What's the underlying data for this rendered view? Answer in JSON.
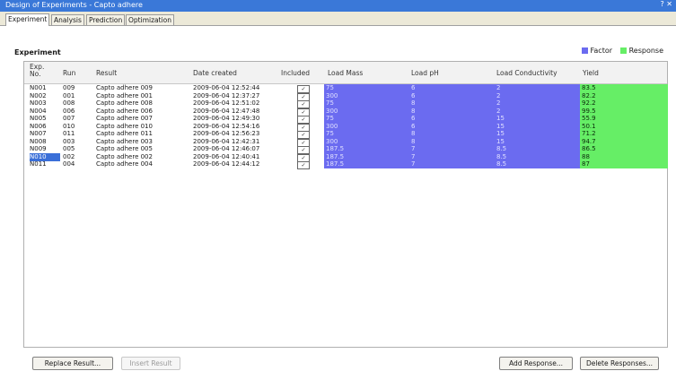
{
  "window": {
    "title": "Design of Experiments - Capto adhere",
    "controls": "? ✕"
  },
  "tabs": [
    {
      "label": "Experiment"
    },
    {
      "label": "Analysis"
    },
    {
      "label": "Prediction"
    },
    {
      "label": "Optimization"
    }
  ],
  "section": {
    "title": "Experiment"
  },
  "legend": {
    "factor_label": "Factor",
    "response_label": "Response",
    "factor_color": "#6b6bf0",
    "response_color": "#66ee66"
  },
  "columns": {
    "exp_no": "Exp. No.",
    "run": "Run",
    "result": "Result",
    "date_created": "Date created",
    "included": "Included",
    "load_mass": "Load Mass",
    "load_ph": "Load pH",
    "load_conductivity": "Load Conductivity",
    "yield": "Yield"
  },
  "rows": [
    {
      "exp_no": "N001",
      "run": "009",
      "result": "Capto adhere 009",
      "date": "2009-06-04 12:52:44",
      "included": "✓",
      "mass": "75",
      "ph": "6",
      "cond": "2",
      "yield": "83.5"
    },
    {
      "exp_no": "N002",
      "run": "001",
      "result": "Capto adhere 001",
      "date": "2009-06-04 12:37:27",
      "included": "✓",
      "mass": "300",
      "ph": "6",
      "cond": "2",
      "yield": "82.2"
    },
    {
      "exp_no": "N003",
      "run": "008",
      "result": "Capto adhere 008",
      "date": "2009-06-04 12:51:02",
      "included": "✓",
      "mass": "75",
      "ph": "8",
      "cond": "2",
      "yield": "92.2"
    },
    {
      "exp_no": "N004",
      "run": "006",
      "result": "Capto adhere 006",
      "date": "2009-06-04 12:47:48",
      "included": "✓",
      "mass": "300",
      "ph": "8",
      "cond": "2",
      "yield": "99.5"
    },
    {
      "exp_no": "N005",
      "run": "007",
      "result": "Capto adhere 007",
      "date": "2009-06-04 12:49:30",
      "included": "✓",
      "mass": "75",
      "ph": "6",
      "cond": "15",
      "yield": "55.9"
    },
    {
      "exp_no": "N006",
      "run": "010",
      "result": "Capto adhere 010",
      "date": "2009-06-04 12:54:16",
      "included": "✓",
      "mass": "300",
      "ph": "6",
      "cond": "15",
      "yield": "50.1"
    },
    {
      "exp_no": "N007",
      "run": "011",
      "result": "Capto adhere 011",
      "date": "2009-06-04 12:56:23",
      "included": "✓",
      "mass": "75",
      "ph": "8",
      "cond": "15",
      "yield": "71.2"
    },
    {
      "exp_no": "N008",
      "run": "003",
      "result": "Capto adhere 003",
      "date": "2009-06-04 12:42:31",
      "included": "✓",
      "mass": "300",
      "ph": "8",
      "cond": "15",
      "yield": "94.7"
    },
    {
      "exp_no": "N009",
      "run": "005",
      "result": "Capto adhere 005",
      "date": "2009-06-04 12:46:07",
      "included": "✓",
      "mass": "187.5",
      "ph": "7",
      "cond": "8.5",
      "yield": "86.5"
    },
    {
      "exp_no": "N010",
      "run": "002",
      "result": "Capto adhere 002",
      "date": "2009-06-04 12:40:41",
      "included": "✓",
      "mass": "187.5",
      "ph": "7",
      "cond": "8.5",
      "yield": "88"
    },
    {
      "exp_no": "N011",
      "run": "004",
      "result": "Capto adhere 004",
      "date": "2009-06-04 12:44:12",
      "included": "✓",
      "mass": "187.5",
      "ph": "7",
      "cond": "8.5",
      "yield": "87"
    }
  ],
  "buttons": {
    "replace_result": "Replace Result...",
    "insert_result": "Insert Result",
    "add_response": "Add Response...",
    "delete_responses": "Delete Responses..."
  }
}
